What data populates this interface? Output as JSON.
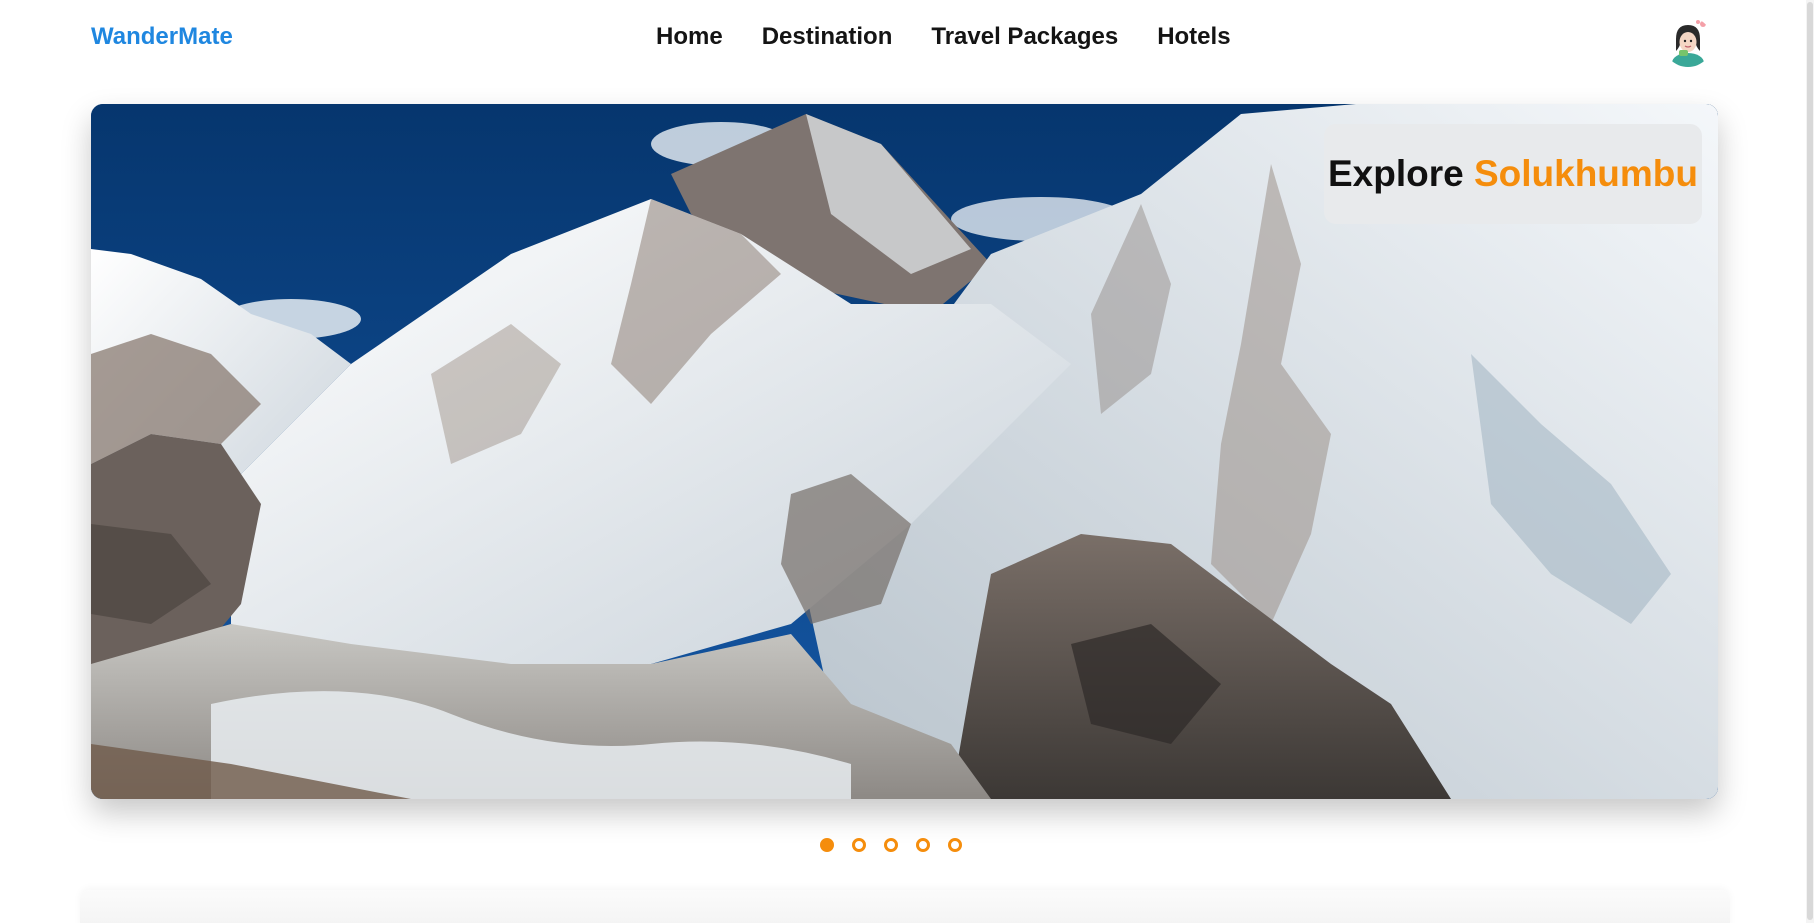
{
  "brand": {
    "name": "WanderMate"
  },
  "nav": {
    "items": [
      {
        "label": "Home"
      },
      {
        "label": "Destination"
      },
      {
        "label": "Travel Packages"
      },
      {
        "label": "Hotels"
      }
    ]
  },
  "user": {
    "avatar_icon": "user-avatar-icon"
  },
  "hero": {
    "explore_word": "Explore",
    "place": "Solukhumbu",
    "image_subject": "snow-capped-himalaya-mountains",
    "accent_color": "#f58d0c"
  },
  "carousel": {
    "slide_count": 5,
    "active_index": 0
  },
  "colors": {
    "brand": "#1f87e0",
    "accent": "#f58d0c",
    "nav_text": "#141414",
    "card_bg": "#e8eaec"
  }
}
